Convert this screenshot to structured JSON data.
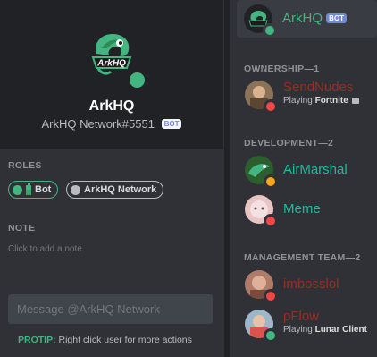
{
  "profile": {
    "name": "ArkHQ",
    "tag": "ArkHQ Network#5551",
    "bot_label": "BOT",
    "logo_text": "ArkHQ",
    "roles_title": "ROLES",
    "roles": [
      {
        "label": "Bot",
        "color": "#43b581"
      },
      {
        "label": "ArkHQ Network",
        "color": "#b9bbbe"
      }
    ],
    "note_title": "NOTE",
    "note_placeholder": "Click to add a note",
    "message_placeholder": "Message @ArkHQ Network",
    "protip_label": "PROTIP:",
    "protip_text": "Right click user for more actions",
    "status_color": "#43b581"
  },
  "member_list": {
    "top_member": {
      "name": "ArkHQ",
      "bot_label": "BOT",
      "name_color": "#43b581"
    },
    "groups": [
      {
        "title": "OWNERSHIP—1",
        "members": [
          {
            "name": "SendNudes",
            "color": "#992d22",
            "activity_prefix": "Playing",
            "activity": "Fortnite",
            "status": "dnd"
          }
        ]
      },
      {
        "title": "DEVELOPMENT—2",
        "members": [
          {
            "name": "AirMarshal",
            "color": "#1abc9c",
            "status": "idle"
          },
          {
            "name": "Meme",
            "color": "#1abc9c",
            "status": "dnd"
          }
        ]
      },
      {
        "title": "MANAGEMENT TEAM—2",
        "members": [
          {
            "name": "imbosslol",
            "color": "#992d22",
            "status": "dnd"
          },
          {
            "name": "pFlow",
            "color": "#992d22",
            "activity_prefix": "Playing",
            "activity": "Lunar Client",
            "status": "online"
          }
        ]
      }
    ],
    "status_colors": {
      "online": "#43b581",
      "idle": "#faa61a",
      "dnd": "#f04747"
    }
  }
}
